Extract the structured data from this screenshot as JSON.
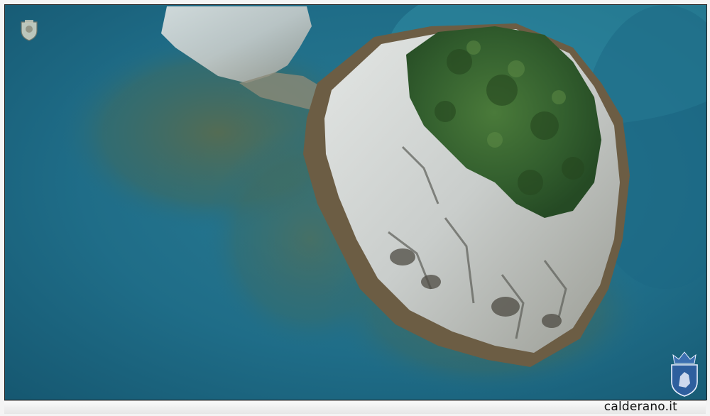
{
  "photo": {
    "subject": "aerial-view-rocky-islet-in-sea",
    "colors": {
      "deep_sea": "#1c6a86",
      "shallow_sea": "#2f8aa0",
      "rock": "#cfd3d2",
      "vegetation": "#2f5a2c"
    }
  },
  "watermark": {
    "caption": "calderano.it",
    "emblem_top_left": "crest-icon",
    "emblem_bottom_right": "lion-crest-icon"
  }
}
